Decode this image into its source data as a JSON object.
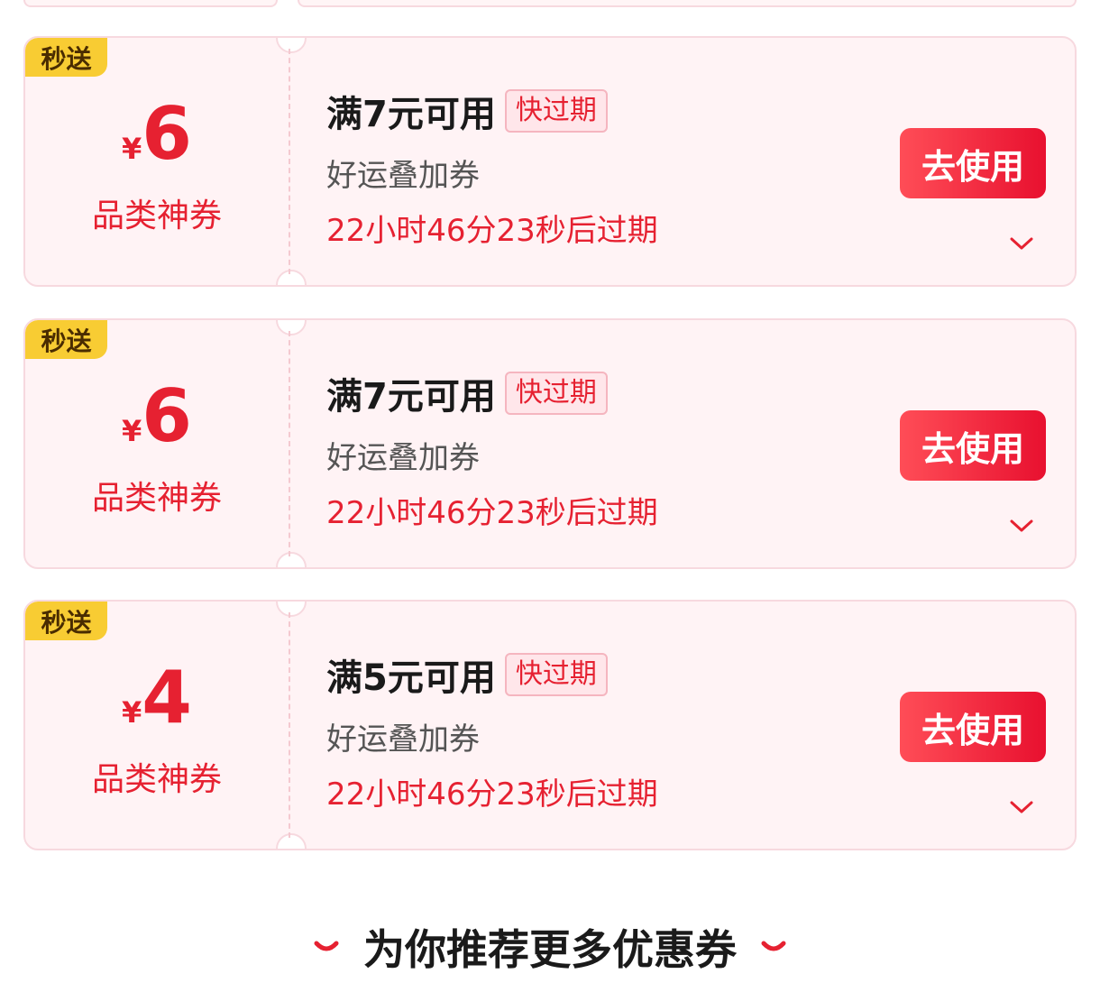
{
  "coupons": [
    {
      "tag": "秒送",
      "currency": "¥",
      "amount": "6",
      "category": "品类神券",
      "condition": "满7元可用",
      "badge": "快过期",
      "type_name": "好运叠加券",
      "countdown": "22小时46分23秒后过期",
      "button": "去使用"
    },
    {
      "tag": "秒送",
      "currency": "¥",
      "amount": "6",
      "category": "品类神券",
      "condition": "满7元可用",
      "badge": "快过期",
      "type_name": "好运叠加券",
      "countdown": "22小时46分23秒后过期",
      "button": "去使用"
    },
    {
      "tag": "秒送",
      "currency": "¥",
      "amount": "4",
      "category": "品类神券",
      "condition": "满5元可用",
      "badge": "快过期",
      "type_name": "好运叠加券",
      "countdown": "22小时46分23秒后过期",
      "button": "去使用"
    }
  ],
  "footer": {
    "title": "为你推荐更多优惠券"
  },
  "colors": {
    "accent": "#e62131",
    "tag_yellow": "#f8cc33",
    "card_bg": "#fff3f5"
  }
}
